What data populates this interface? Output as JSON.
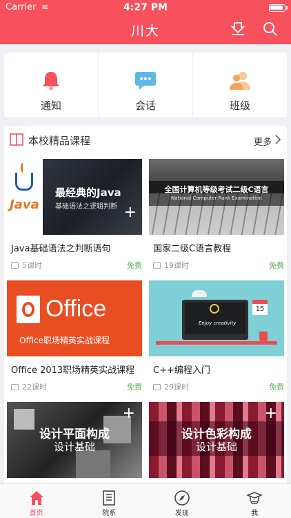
{
  "status": {
    "carrier": "Carrier",
    "wifi": "wifi",
    "time": "4:27 PM"
  },
  "header": {
    "title": "川大",
    "download_icon": "download-icon",
    "search_icon": "search-icon"
  },
  "colors": {
    "brand": "#f6515d",
    "free": "#5ab95a"
  },
  "quick_nav": [
    {
      "label": "通知",
      "icon": "bell-icon"
    },
    {
      "label": "会话",
      "icon": "chat-bubble-icon"
    },
    {
      "label": "班级",
      "icon": "people-icon"
    }
  ],
  "courses": {
    "title": "本校精品课程",
    "more": "更多",
    "items": [
      {
        "title": "Java基础语法之判断语句",
        "lessons": "5课时",
        "price": "免费",
        "image": {
          "logo": "Java",
          "h1": "最经典的Java",
          "h2": "基础语法之逻辑判断"
        }
      },
      {
        "title": "国家二级C语言教程",
        "lessons": "19课时",
        "price": "免费",
        "image": {
          "h1": "全国计算机等级考试二级C语言",
          "h2": "National Computer Rank Examination"
        }
      },
      {
        "title": "Office 2013职场精英实战课程",
        "lessons": "22课时",
        "price": "免费",
        "image": {
          "h1": "Office",
          "h2": "Office职场精英实战课程"
        }
      },
      {
        "title": "C++编程入门",
        "lessons": "29课时",
        "price": "免费",
        "image": {
          "h1": "Enjoy creativity",
          "cal": "15"
        }
      },
      {
        "image": {
          "h1": "设计平面构成",
          "h2": "设计基础"
        }
      },
      {
        "image": {
          "h1": "设计色彩构成",
          "h2": "设计基础"
        }
      }
    ]
  },
  "tabbar": [
    {
      "label": "首页",
      "icon": "home-icon",
      "active": true
    },
    {
      "label": "院系",
      "icon": "book-icon",
      "active": false
    },
    {
      "label": "发现",
      "icon": "compass-icon",
      "active": false
    },
    {
      "label": "我",
      "icon": "graduation-cap-icon",
      "active": false
    }
  ]
}
